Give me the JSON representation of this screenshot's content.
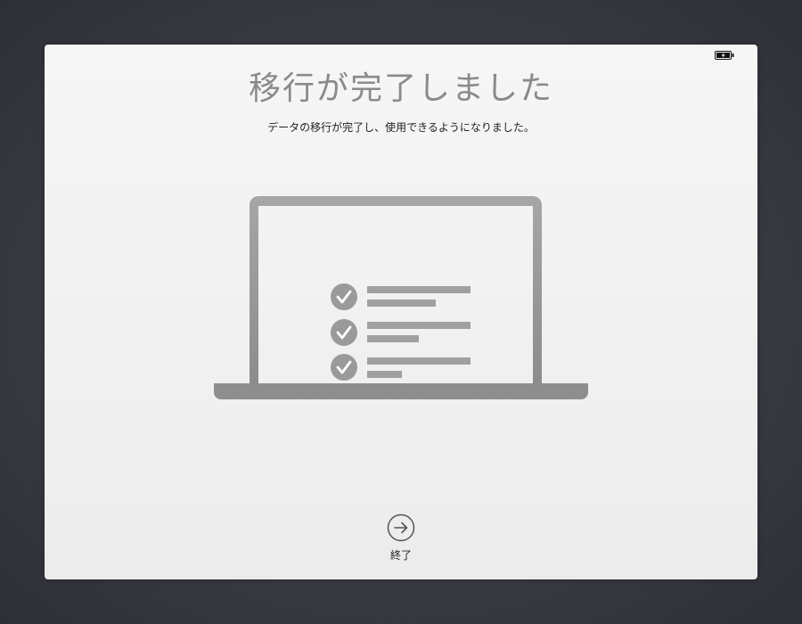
{
  "title": "移行が完了しました",
  "subtitle": "データの移行が完了し、使用できるようになりました。",
  "status_bar": {
    "battery_icon": "battery-charging-icon"
  },
  "illustration": {
    "checklist_items": 3,
    "icon": "laptop-checklist-icon"
  },
  "finish_button": {
    "label": "終了",
    "icon": "arrow-right-circle-icon"
  },
  "colors": {
    "title": "#8a8a8a",
    "illustration_gray": "#9a9a9a",
    "background": "#3a3b42"
  }
}
